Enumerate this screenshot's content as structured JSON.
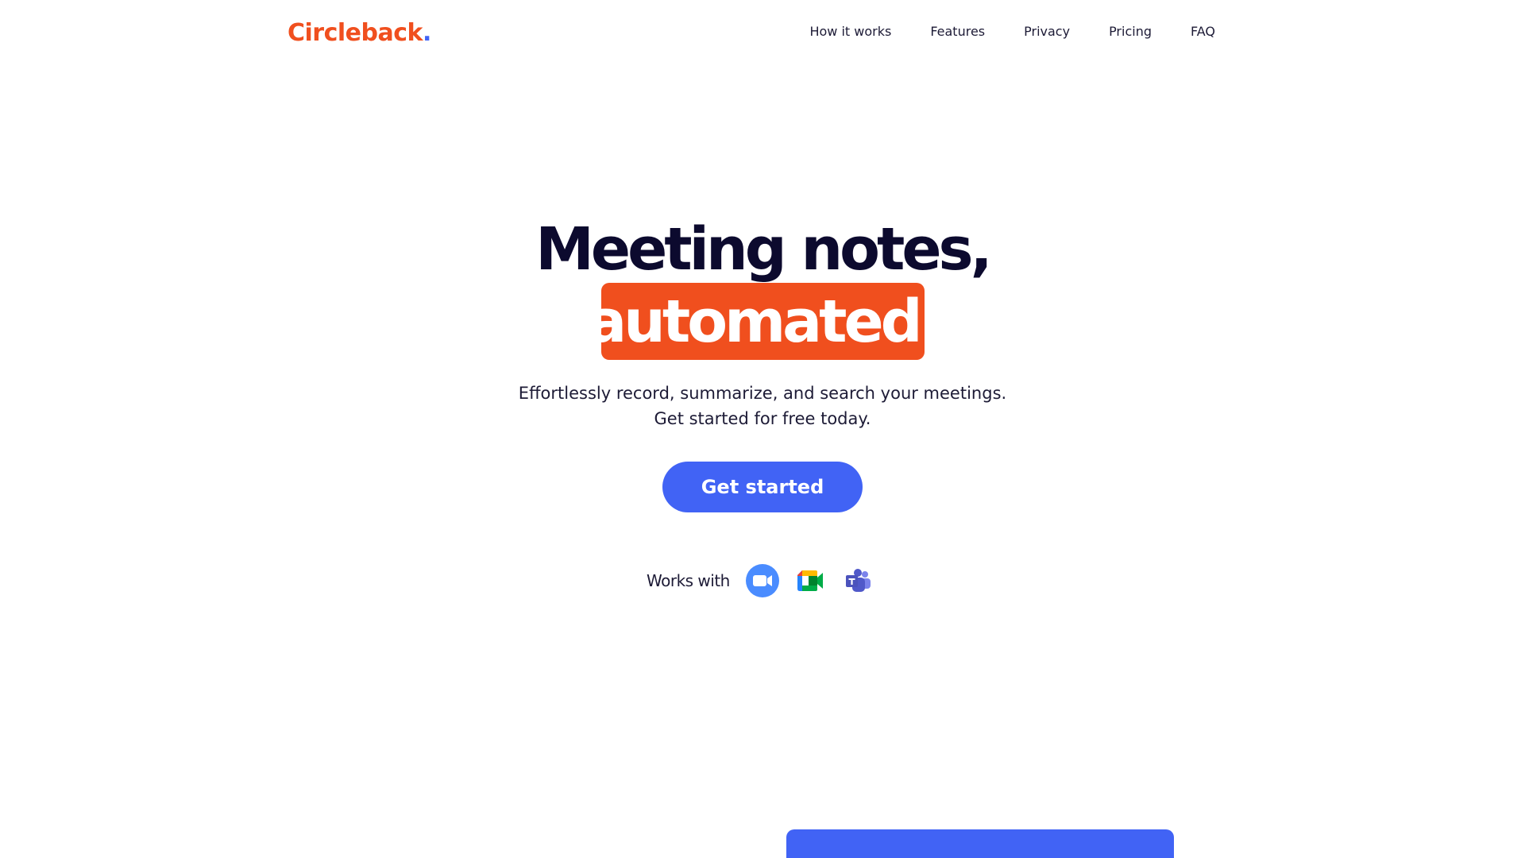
{
  "brand": {
    "name": "Circleback",
    "dot": ".",
    "color": "#f04f1e",
    "dot_color": "#4163f5"
  },
  "nav": {
    "items": [
      {
        "label": "How it works"
      },
      {
        "label": "Features"
      },
      {
        "label": "Privacy"
      },
      {
        "label": "Pricing"
      },
      {
        "label": "FAQ"
      }
    ]
  },
  "hero": {
    "title_line1": "Meeting notes,",
    "title_line2": "automated.",
    "subtitle_line1": "Effortlessly record, summarize, and search your meetings.",
    "subtitle_line2": "Get started for free today.",
    "cta_label": "Get started",
    "accent_color": "#f04f1e",
    "cta_color": "#4163f5"
  },
  "integrations": {
    "label": "Works with",
    "icons": [
      "zoom-icon",
      "google-meet-icon",
      "microsoft-teams-icon"
    ]
  }
}
